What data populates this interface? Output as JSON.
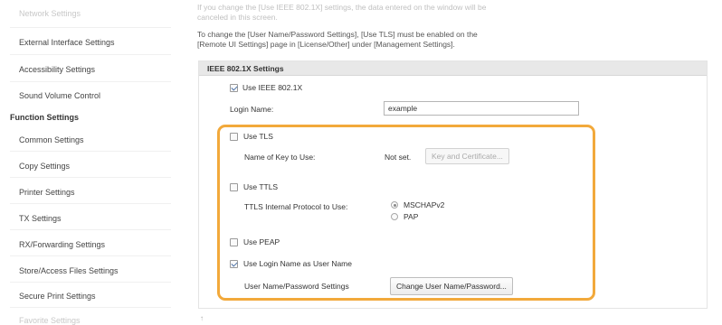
{
  "sidebar": {
    "items": [
      {
        "label": "Network Settings",
        "faded": true
      },
      {
        "label": "External Interface Settings"
      },
      {
        "label": "Accessibility Settings"
      },
      {
        "label": "Sound Volume Control"
      }
    ],
    "section_heading": "Function Settings",
    "function_items": [
      {
        "label": "Common Settings"
      },
      {
        "label": "Copy Settings"
      },
      {
        "label": "Printer Settings"
      },
      {
        "label": "TX Settings"
      },
      {
        "label": "RX/Forwarding Settings"
      },
      {
        "label": "Store/Access Files Settings"
      },
      {
        "label": "Secure Print Settings"
      },
      {
        "label": "Favorite Settings",
        "faded": true
      }
    ]
  },
  "notes": {
    "line1": "If you change the [Use IEEE 802.1X] settings, the data entered on the window will be",
    "line2": "canceled in this screen.",
    "line3": "To change the [User Name/Password Settings], [Use TLS] must be enabled on the",
    "line4": "[Remote UI Settings] page in [License/Other] under [Management Settings]."
  },
  "ieee": {
    "title": "IEEE 802.1X Settings",
    "use_ieee_label": "Use IEEE 802.1X",
    "use_ieee_checked": true,
    "login_name_label": "Login Name:",
    "login_name_value": "example",
    "use_tls_label": "Use TLS",
    "use_tls_checked": false,
    "key_label": "Name of Key to Use:",
    "key_value": "Not set.",
    "key_button": "Key and Certificate...",
    "use_ttls_label": "Use TTLS",
    "use_ttls_checked": false,
    "ttls_protocol_label": "TTLS Internal Protocol to Use:",
    "protocol_options": [
      {
        "label": "MSCHAPv2",
        "selected": true
      },
      {
        "label": "PAP",
        "selected": false
      }
    ],
    "use_peap_label": "Use PEAP",
    "use_peap_checked": false,
    "use_login_as_user_label": "Use Login Name as User Name",
    "use_login_as_user_checked": true,
    "user_pass_label": "User Name/Password Settings",
    "user_pass_button": "Change User Name/Password..."
  },
  "bottom_mark": "↑",
  "colors": {
    "highlight": "#f2a93b",
    "section_header_bg": "#e8e8e8"
  }
}
